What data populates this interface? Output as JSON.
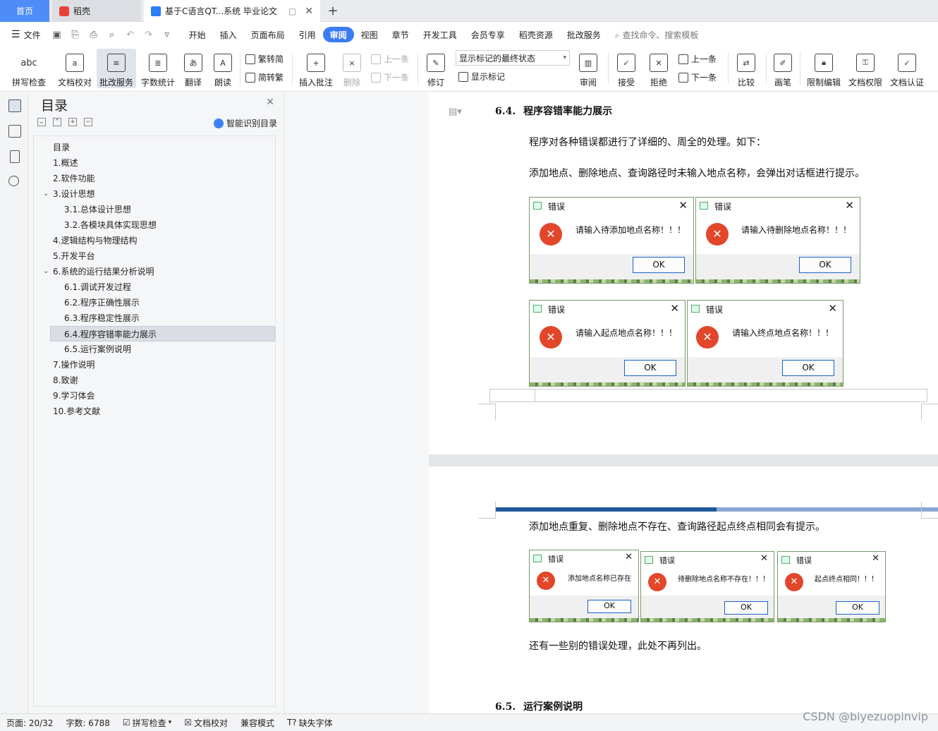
{
  "tabs": {
    "home": "首页",
    "daoke": "稻壳",
    "doc": "基于C语言QT...系统 毕业论文",
    "add": "+"
  },
  "menu": {
    "file": "文件",
    "items": [
      "开始",
      "插入",
      "页面布局",
      "引用",
      "审阅",
      "视图",
      "章节",
      "开发工具",
      "会员专享",
      "稻壳资源",
      "批改服务"
    ],
    "active_index": 4,
    "search_placeholder": "查找命令、搜索模板"
  },
  "toolbar": {
    "spell": "拼写检查",
    "proofread": "文档校对",
    "correct": "批改服务",
    "wordcount": "字数统计",
    "translate": "翻译",
    "read": "朗读",
    "t2s": "繁转简",
    "s2t": "简转繁",
    "insert_comment": "插入批注",
    "delete": "删除",
    "prev": "上一条",
    "next": "下一条",
    "revise": "修订",
    "markup_state": "显示标记的最终状态",
    "show_markup": "显示标记",
    "review": "审阅",
    "accept": "接受",
    "reject": "拒绝",
    "prev2": "上一条",
    "next2": "下一条",
    "compare": "比较",
    "pen": "画笔",
    "restrict": "限制编辑",
    "permission": "文档权限",
    "certify": "文档认证",
    "abc": "abc"
  },
  "nav": {
    "title": "目录",
    "smart_label": "智能识别目录",
    "items": [
      "目录",
      "1.概述",
      "2.软件功能",
      "3.设计思想",
      "3.1.总体设计思想",
      "3.2.各模块具体实现思想",
      "4.逻辑结构与物理结构",
      "5.开发平台",
      "6.系统的运行结果分析说明",
      "6.1.调试开发过程",
      "6.2.程序正确性展示",
      "6.3.程序稳定性展示",
      "6.4.程序容错率能力展示",
      "6.5.运行案例说明",
      "7.操作说明",
      "8.致谢",
      "9.学习体会",
      "10.参考文献"
    ],
    "selected_index": 12
  },
  "doc": {
    "heading1_num": "6.4.",
    "heading1": "程序容错率能力展示",
    "para1": "程序对各种错误都进行了详细的、周全的处理。如下：",
    "para2": "添加地点、删除地点、查询路径时未输入地点名称，会弹出对话框进行提示。",
    "para3": "添加地点重复、删除地点不存在、查询路径起点终点相同会有提示。",
    "para4": "还有一些别的错误处理，此处不再列出。",
    "heading2_num": "6.5.",
    "heading2": "运行案例说明",
    "dialog_title": "错误",
    "ok": "OK",
    "dialogs": [
      "请输入待添加地点名称！！！",
      "请输入待删除地点名称！！！",
      "请输入起点地点名称！！！",
      "请输入终点地点名称！！！",
      "添加地点名称已存在",
      "待删除地点名称不存在！！！",
      "起点终点相同！！！"
    ]
  },
  "status": {
    "page": "页面: 20/32",
    "words": "字数: 6788",
    "spell": "拼写检查",
    "proof": "文档校对",
    "compat": "兼容模式",
    "font": "缺失字体"
  },
  "watermark": "CSDN @biyezuopinvip",
  "colors": {
    "accent": "#3b7cf5",
    "error": "#e2462b",
    "ok_border": "#1a64c8"
  }
}
